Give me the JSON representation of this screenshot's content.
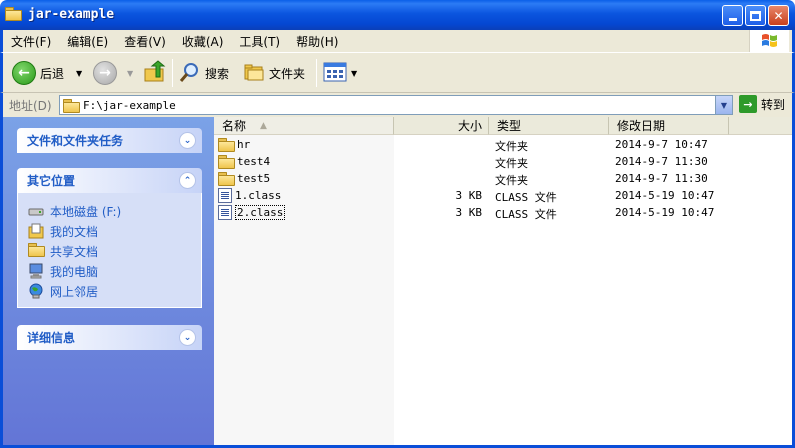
{
  "window": {
    "title": "jar-example"
  },
  "menu": [
    "文件(F)",
    "编辑(E)",
    "查看(V)",
    "收藏(A)",
    "工具(T)",
    "帮助(H)"
  ],
  "toolbar": {
    "back_label": "后退",
    "search_label": "搜索",
    "folders_label": "文件夹"
  },
  "address": {
    "label": "地址(D)",
    "path": "F:\\jar-example",
    "go_label": "转到"
  },
  "left_panel": {
    "tasks_title": "文件和文件夹任务",
    "other_title": "其它位置",
    "places": [
      {
        "label": "本地磁盘 (F:)",
        "icon": "drive-icon"
      },
      {
        "label": "我的文档",
        "icon": "my-documents-icon"
      },
      {
        "label": "共享文档",
        "icon": "shared-documents-icon"
      },
      {
        "label": "我的电脑",
        "icon": "my-computer-icon"
      },
      {
        "label": "网上邻居",
        "icon": "network-icon"
      }
    ],
    "details_title": "详细信息"
  },
  "columns": {
    "name": "名称",
    "size": "大小",
    "type": "类型",
    "modified": "修改日期"
  },
  "files": [
    {
      "name": "hr",
      "size": "",
      "type": "文件夹",
      "modified": "2014-9-7 10:47",
      "icon": "folder-icon"
    },
    {
      "name": "test4",
      "size": "",
      "type": "文件夹",
      "modified": "2014-9-7 11:30",
      "icon": "folder-icon"
    },
    {
      "name": "test5",
      "size": "",
      "type": "文件夹",
      "modified": "2014-9-7 11:30",
      "icon": "folder-icon"
    },
    {
      "name": "1.class",
      "size": "3 KB",
      "type": "CLASS 文件",
      "modified": "2014-5-19 10:47",
      "icon": "class-file-icon"
    },
    {
      "name": "2.class",
      "size": "3 KB",
      "type": "CLASS 文件",
      "modified": "2014-5-19 10:47",
      "icon": "class-file-icon",
      "focused": true
    }
  ]
}
